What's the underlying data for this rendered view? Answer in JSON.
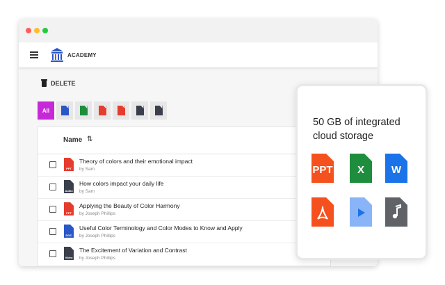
{
  "app": {
    "brand": "ACADEMY"
  },
  "toolbar": {
    "delete_label": "DELETE"
  },
  "filters": {
    "all_label": "All"
  },
  "table": {
    "header_name": "Name",
    "rows": [
      {
        "title": "Theory of colors and their emotional impact",
        "by": "by Sam",
        "type": "PPT",
        "color": "#e53c2e"
      },
      {
        "title": "How colors impact your daily life",
        "by": "by Sam",
        "type": "Audio",
        "color": "#3a3f4b"
      },
      {
        "title": "Applying the Beauty of Color Harmony",
        "by": "by Joseph Phillips",
        "type": "PPT",
        "color": "#e53c2e"
      },
      {
        "title": "Useful Color Terminology and Color Modes to Know and Apply",
        "by": "by Joseph Phillips",
        "type": "DOC",
        "color": "#2a56c6"
      },
      {
        "title": "The Excitement of Variation and Contrast",
        "by": "by Joseph Phillips",
        "type": "Video",
        "color": "#3a3f4b"
      }
    ]
  },
  "card": {
    "title": "50 GB of integrated cloud storage",
    "icons": [
      {
        "label": "PPT",
        "color": "#f4511e",
        "name": "ppt-file-icon"
      },
      {
        "label": "X",
        "color": "#1e8e3e",
        "name": "excel-file-icon"
      },
      {
        "label": "W",
        "color": "#1a73e8",
        "name": "word-file-icon"
      },
      {
        "label": "",
        "color": "#f4511e",
        "name": "pdf-file-icon"
      },
      {
        "label": "",
        "color": "#8ab4f8",
        "name": "video-file-icon"
      },
      {
        "label": "",
        "color": "#5f6368",
        "name": "audio-file-icon"
      }
    ]
  },
  "colors": {
    "all_filter": "#c62ad8"
  }
}
